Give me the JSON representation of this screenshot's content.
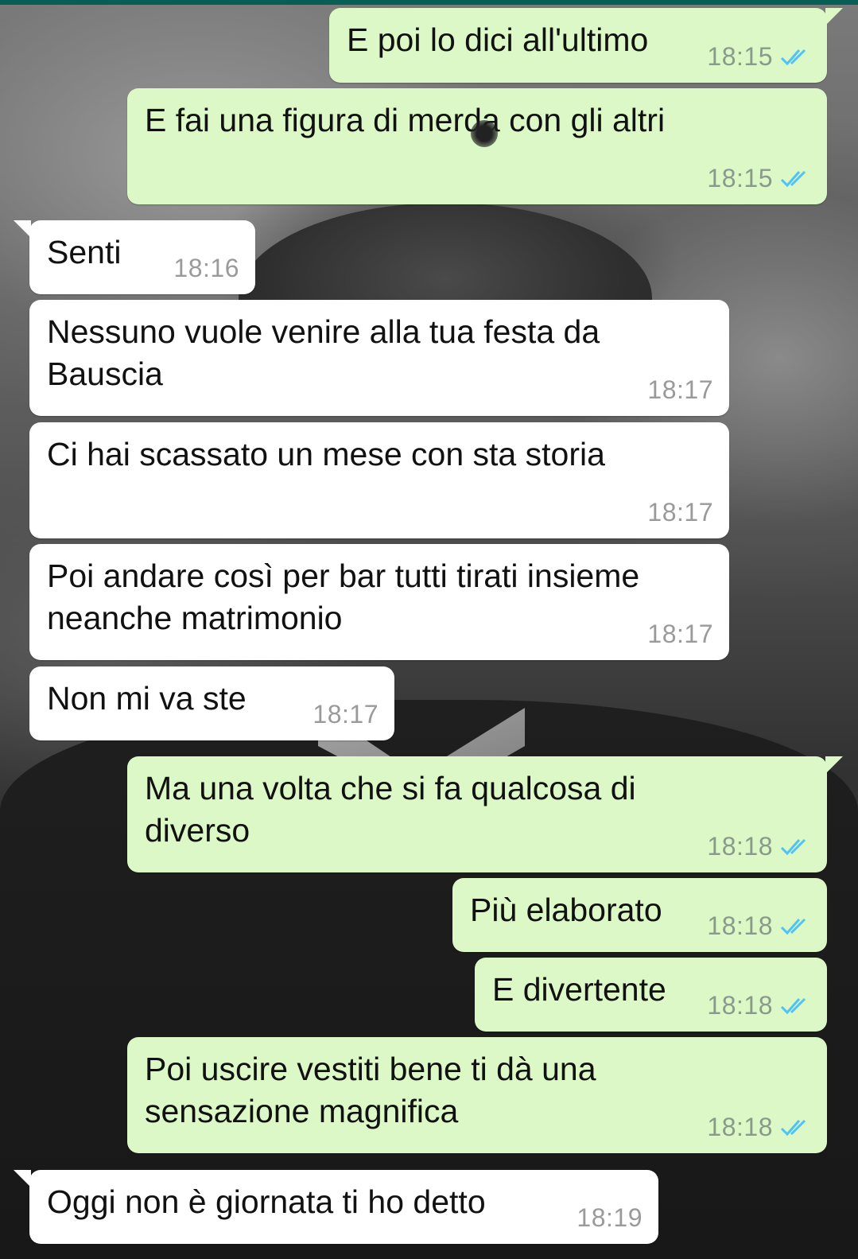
{
  "messages": [
    {
      "text": "E poi lo dici all'ultimo",
      "time": "18:15"
    },
    {
      "text": "E fai una figura di merda con gli altri",
      "time": "18:15"
    },
    {
      "text": "Senti",
      "time": "18:16"
    },
    {
      "text_lines": [
        "Nessuno vuole venire alla tua festa da",
        "Bauscia"
      ],
      "time": "18:17"
    },
    {
      "text": "Ci hai scassato un mese con sta storia",
      "time": "18:17"
    },
    {
      "text_lines": [
        "Poi andare così per bar tutti tirati insieme",
        "neanche matrimonio"
      ],
      "time": "18:17"
    },
    {
      "text": "Non mi va ste",
      "time": "18:17"
    },
    {
      "text_lines": [
        "Ma una volta che si fa qualcosa di",
        "diverso"
      ],
      "time": "18:18"
    },
    {
      "text": "Più elaborato",
      "time": "18:18"
    },
    {
      "text": "E divertente",
      "time": "18:18"
    },
    {
      "text_lines": [
        "Poi uscire vestiti bene ti dà una",
        "sensazione magnifica"
      ],
      "time": "18:18"
    },
    {
      "text": "Oggi non è giornata ti ho detto",
      "time": "18:19"
    }
  ],
  "colors": {
    "outgoing_bubble": "#dcf8c6",
    "incoming_bubble": "#ffffff",
    "read_ticks": "#4fc3f7",
    "header": "#075e54"
  },
  "icons": {
    "read_receipt": "double-check-icon"
  }
}
